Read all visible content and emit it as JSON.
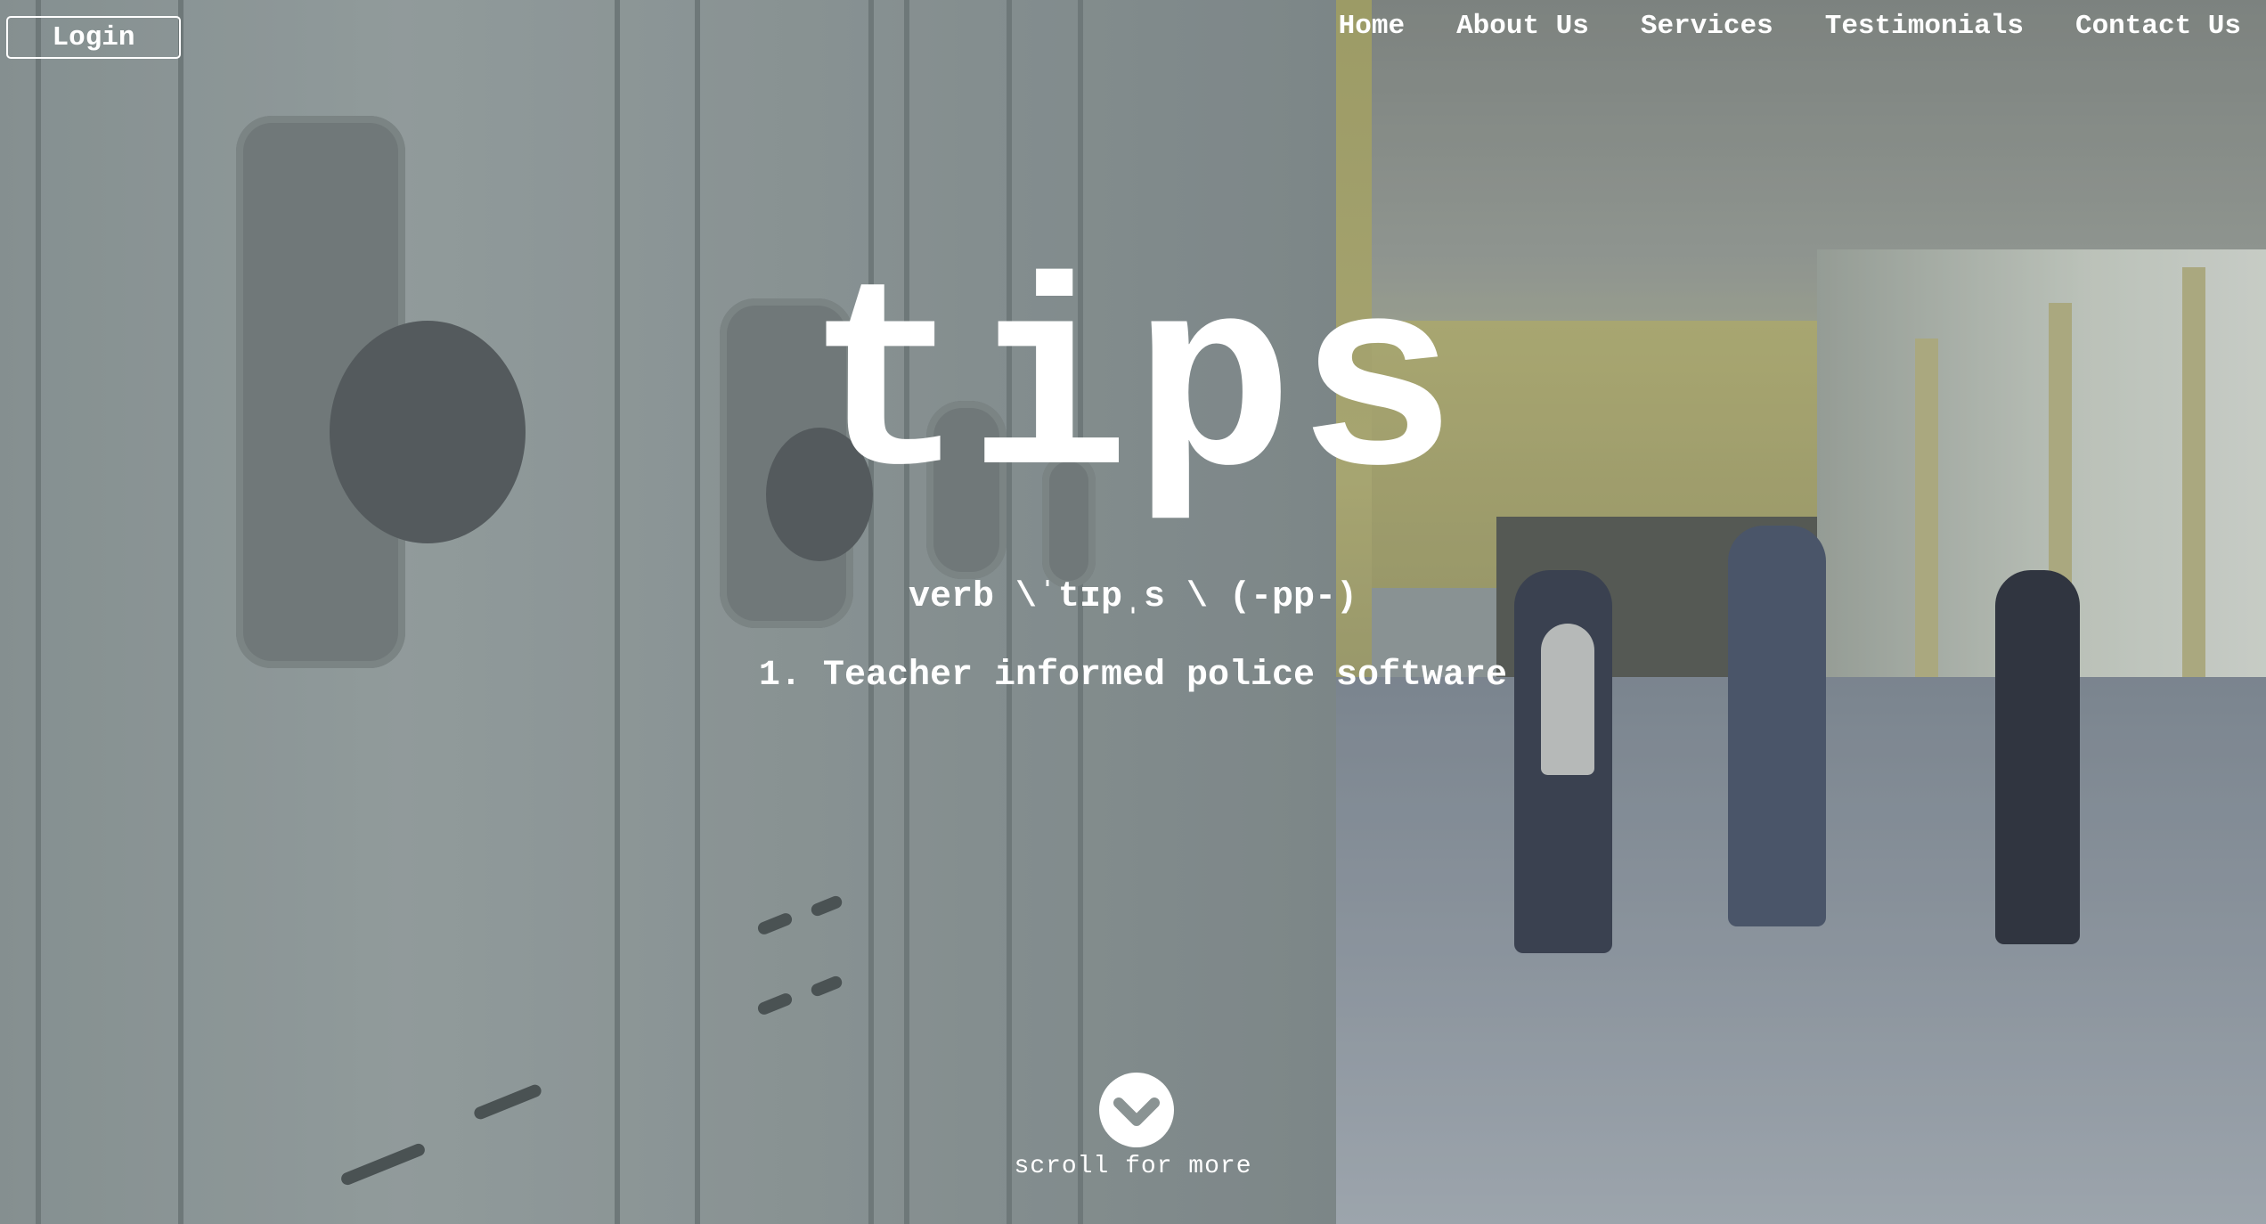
{
  "header": {
    "login_label": "Login",
    "nav": [
      "Home",
      "About Us",
      "Services",
      "Testimonials",
      "Contact Us"
    ]
  },
  "hero": {
    "title": "tips",
    "pronunciation": "verb \\ˈtɪpˌs \\ (-pp-)",
    "definition": "1. Teacher informed police software",
    "scroll_label": "scroll for more",
    "scroll_icon": "chevron-down-circle-icon"
  },
  "background": {
    "image_subject": "school hallway with lockers and walking students",
    "colors": {
      "text": "#ffffff",
      "locker": "#9ea8a5",
      "wall": "#c5c07a"
    }
  }
}
